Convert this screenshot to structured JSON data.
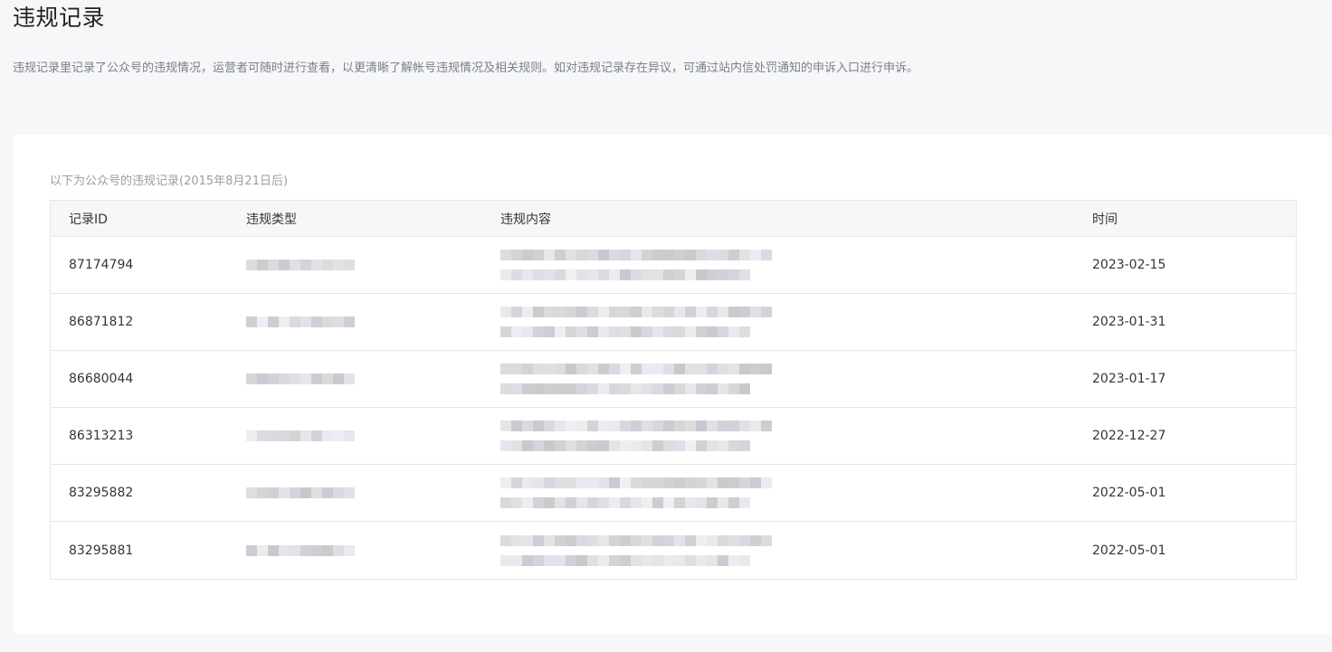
{
  "page": {
    "title": "违规记录",
    "description": "违规记录里记录了公众号的违规情况，运营者可随时进行查看，以更清晰了解帐号违规情况及相关规则。如对违规记录存在异议，可通过站内信处罚通知的申诉入口进行申诉。"
  },
  "records": {
    "note": "以下为公众号的违规记录(2015年8月21日后)",
    "columns": {
      "id": "记录ID",
      "type": "违规类型",
      "content": "违规内容",
      "time": "时间"
    },
    "rows": [
      {
        "id": "87174794",
        "time": "2023-02-15"
      },
      {
        "id": "86871812",
        "time": "2023-01-31"
      },
      {
        "id": "86680044",
        "time": "2023-01-17"
      },
      {
        "id": "86313213",
        "time": "2022-12-27"
      },
      {
        "id": "83295882",
        "time": "2022-05-01"
      },
      {
        "id": "83295881",
        "time": "2022-05-01"
      }
    ]
  }
}
